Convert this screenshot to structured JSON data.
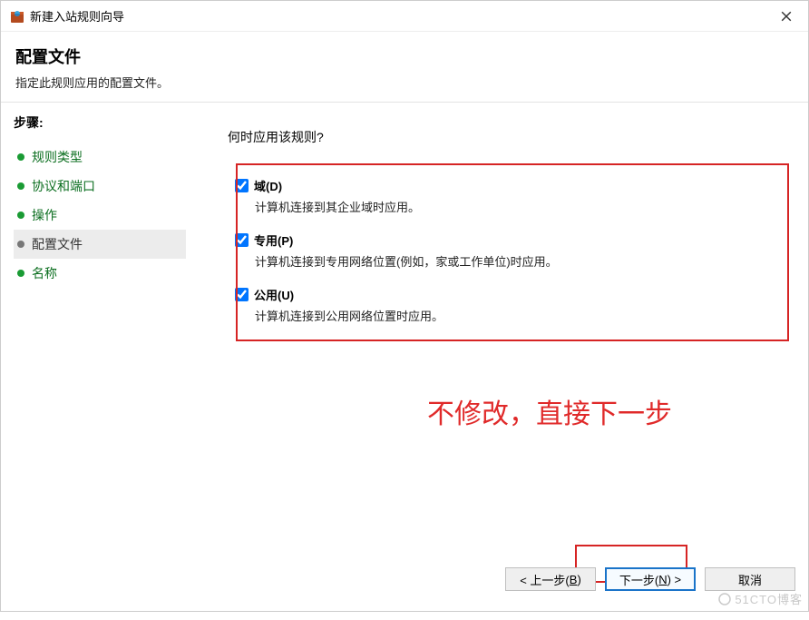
{
  "window": {
    "title": "新建入站规则向导"
  },
  "header": {
    "title": "配置文件",
    "subtitle": "指定此规则应用的配置文件。"
  },
  "sidebar": {
    "steps_label": "步骤:",
    "items": [
      {
        "label": "规则类型",
        "active": false
      },
      {
        "label": "协议和端口",
        "active": false
      },
      {
        "label": "操作",
        "active": false
      },
      {
        "label": "配置文件",
        "active": true
      },
      {
        "label": "名称",
        "active": false
      }
    ]
  },
  "main": {
    "question": "何时应用该规则?",
    "profiles": [
      {
        "checked": true,
        "name": "域(D)",
        "desc": "计算机连接到其企业域时应用。"
      },
      {
        "checked": true,
        "name": "专用(P)",
        "desc": "计算机连接到专用网络位置(例如，家或工作单位)时应用。"
      },
      {
        "checked": true,
        "name": "公用(U)",
        "desc": "计算机连接到公用网络位置时应用。"
      }
    ]
  },
  "annotation": {
    "text": "不修改，直接下一步"
  },
  "footer": {
    "back_pre": "< 上一步(",
    "back_u": "B",
    "back_post": ")",
    "next_pre": "下一步(",
    "next_u": "N",
    "next_post": ") >",
    "cancel": "取消"
  },
  "watermark": {
    "text": "51CTO博客"
  }
}
